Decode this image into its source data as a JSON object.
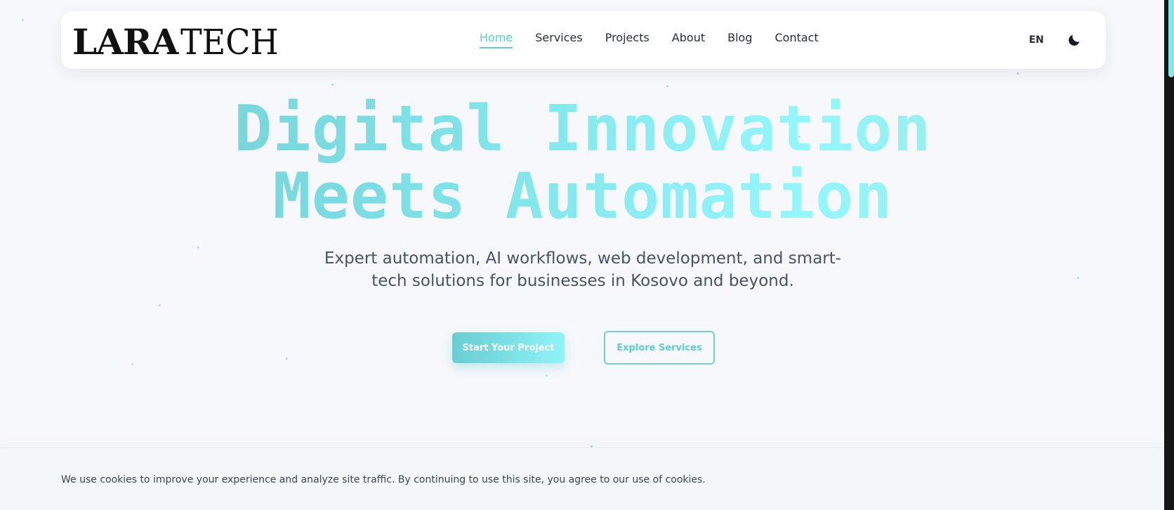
{
  "brand": {
    "logo_bold": "LARA",
    "logo_light": "TECH"
  },
  "nav": {
    "items": [
      {
        "label": "Home",
        "active": true
      },
      {
        "label": "Services",
        "active": false
      },
      {
        "label": "Projects",
        "active": false
      },
      {
        "label": "About",
        "active": false
      },
      {
        "label": "Blog",
        "active": false
      },
      {
        "label": "Contact",
        "active": false
      }
    ],
    "language": "EN",
    "theme_icon": "moon-icon"
  },
  "hero": {
    "title_line1": "Digital Innovation",
    "title_line2": "Meets Automation",
    "subtitle": "Expert automation, AI workflows, web development, and smart-tech solutions for businesses in Kosovo and beyond.",
    "primary_cta": "Start Your Project",
    "secondary_cta": "Explore Services"
  },
  "cookie": {
    "text": "We use cookies to improve your experience and analyze site traffic. By continuing to use this site, you agree to our use of cookies."
  },
  "colors": {
    "accent": "#5ccdd1",
    "accent_light": "#8ef4f7",
    "text_dark": "#2a2d35",
    "background": "#f6f8fb"
  }
}
